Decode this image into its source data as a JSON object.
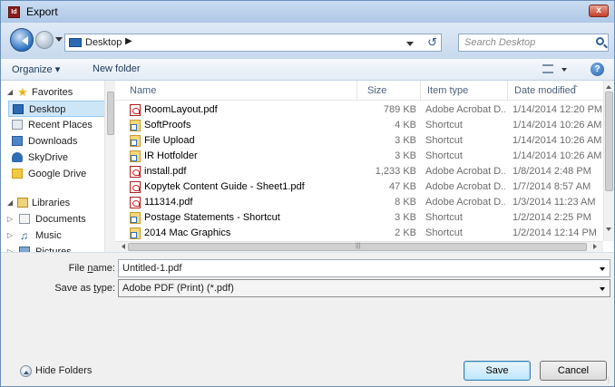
{
  "window": {
    "title": "Export",
    "app_icon": "Id",
    "close_label": "x"
  },
  "address": {
    "location": "Desktop",
    "chevron": "▶",
    "refresh": "↺"
  },
  "search": {
    "placeholder": "Search Desktop"
  },
  "toolbar": {
    "organize_label": "Organize ▾",
    "new_folder_label": "New folder",
    "help": "?"
  },
  "nav": {
    "items": [
      {
        "label": "Favorites",
        "icon": "star-icon"
      },
      {
        "label": "Desktop",
        "icon": "desktop-icon"
      },
      {
        "label": "Recent Places",
        "icon": "recent-places-icon"
      },
      {
        "label": "Downloads",
        "icon": "downloads-icon"
      },
      {
        "label": "SkyDrive",
        "icon": "skydrive-icon"
      },
      {
        "label": "Google Drive",
        "icon": "google-drive-icon"
      },
      {
        "label": "Libraries",
        "icon": "libraries-icon"
      },
      {
        "label": "Documents",
        "icon": "documents-icon"
      },
      {
        "label": "Music",
        "icon": "music-icon"
      },
      {
        "label": "Pictures",
        "icon": "pictures-icon"
      }
    ]
  },
  "columns": {
    "name": "Name",
    "size": "Size",
    "type": "Item type",
    "date": "Date modified"
  },
  "files": [
    {
      "name": "RoomLayout.pdf",
      "size": "789 KB",
      "type": "Adobe Acrobat D...",
      "date": "1/14/2014 12:20 PM",
      "icon": "pdf-icon"
    },
    {
      "name": "SoftProofs",
      "size": "4 KB",
      "type": "Shortcut",
      "date": "1/14/2014 10:26 AM",
      "icon": "shortcut-icon"
    },
    {
      "name": "File Upload",
      "size": "3 KB",
      "type": "Shortcut",
      "date": "1/14/2014 10:26 AM",
      "icon": "shortcut-icon"
    },
    {
      "name": "IR Hotfolder",
      "size": "3 KB",
      "type": "Shortcut",
      "date": "1/14/2014 10:26 AM",
      "icon": "shortcut-icon"
    },
    {
      "name": "install.pdf",
      "size": "1,233 KB",
      "type": "Adobe Acrobat D...",
      "date": "1/8/2014 2:48 PM",
      "icon": "pdf-icon"
    },
    {
      "name": "Kopytek Content Guide - Sheet1.pdf",
      "size": "47 KB",
      "type": "Adobe Acrobat D...",
      "date": "1/7/2014 8:57 AM",
      "icon": "pdf-icon"
    },
    {
      "name": "111314.pdf",
      "size": "8 KB",
      "type": "Adobe Acrobat D...",
      "date": "1/3/2014 11:23 AM",
      "icon": "pdf-icon"
    },
    {
      "name": "Postage Statements - Shortcut",
      "size": "3 KB",
      "type": "Shortcut",
      "date": "1/2/2014 2:25 PM",
      "icon": "shortcut-icon"
    },
    {
      "name": "2014 Mac Graphics",
      "size": "2 KB",
      "type": "Shortcut",
      "date": "1/2/2014 12:14 PM",
      "icon": "shortcut-icon"
    }
  ],
  "form": {
    "filename_label_pre": "File ",
    "filename_label_ul": "n",
    "filename_label_post": "ame:",
    "filename_value": "Untitled-1.pdf",
    "type_label_pre": "Save as ",
    "type_label_ul": "t",
    "type_label_post": "ype:",
    "type_value": "Adobe PDF (Print) (*.pdf)"
  },
  "footer": {
    "hide_folders": "Hide Folders",
    "save": "Save",
    "cancel": "Cancel"
  },
  "colors": {
    "accent": "#3c7fb1",
    "frame": "#b9d1ea",
    "selected": "#cde6f7"
  }
}
